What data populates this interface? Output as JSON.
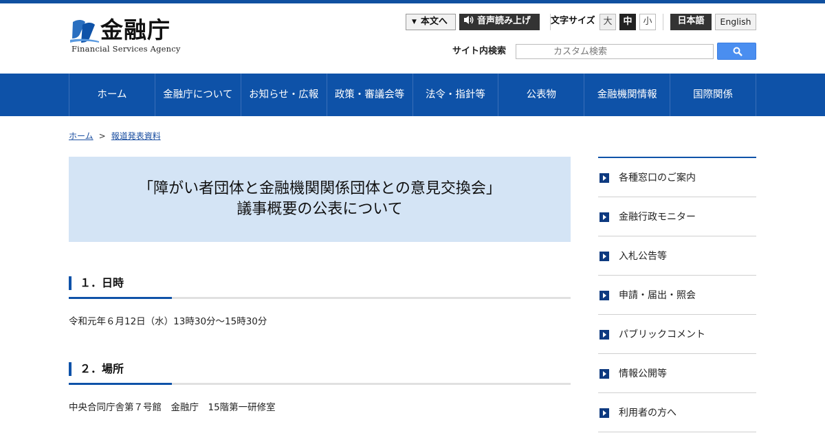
{
  "header": {
    "logo_text": "金融庁",
    "logo_sub": "Financial Services Agency",
    "skip_label": "本文へ",
    "voice_label": "音声読み上げ",
    "font_size_label": "文字サイズ",
    "font_sizes": [
      "大",
      "中",
      "小"
    ],
    "lang_ja": "日本語",
    "lang_en": "English",
    "search_label": "サイト内検索",
    "search_placeholder": "カスタム検索"
  },
  "nav": {
    "items": [
      "ホーム",
      "金融庁について",
      "お知らせ・広報",
      "政策・審議会等",
      "法令・指針等",
      "公表物",
      "金融機関情報",
      "国際関係"
    ]
  },
  "breadcrumb": {
    "home": "ホーム",
    "separator": ">",
    "current": "報道発表資料"
  },
  "main": {
    "title_line1": "「障がい者団体と金融機関関係団体との意見交換会」",
    "title_line2": "議事概要の公表について",
    "sections": [
      {
        "heading": "１．日時",
        "body": "令和元年６月12日（水）13時30分～15時30分"
      },
      {
        "heading": "２．場所",
        "body": "中央合同庁舎第７号館　金融庁　15階第一研修室"
      }
    ]
  },
  "sidebar": {
    "items": [
      "各種窓口のご案内",
      "金融行政モニター",
      "入札公告等",
      "申請・届出・照会",
      "パブリックコメント",
      "情報公開等",
      "利用者の方へ"
    ]
  },
  "colors": {
    "brand_blue": "#0e52a8",
    "title_bg": "#d4e4f5",
    "search_button": "#4a8ef0"
  }
}
